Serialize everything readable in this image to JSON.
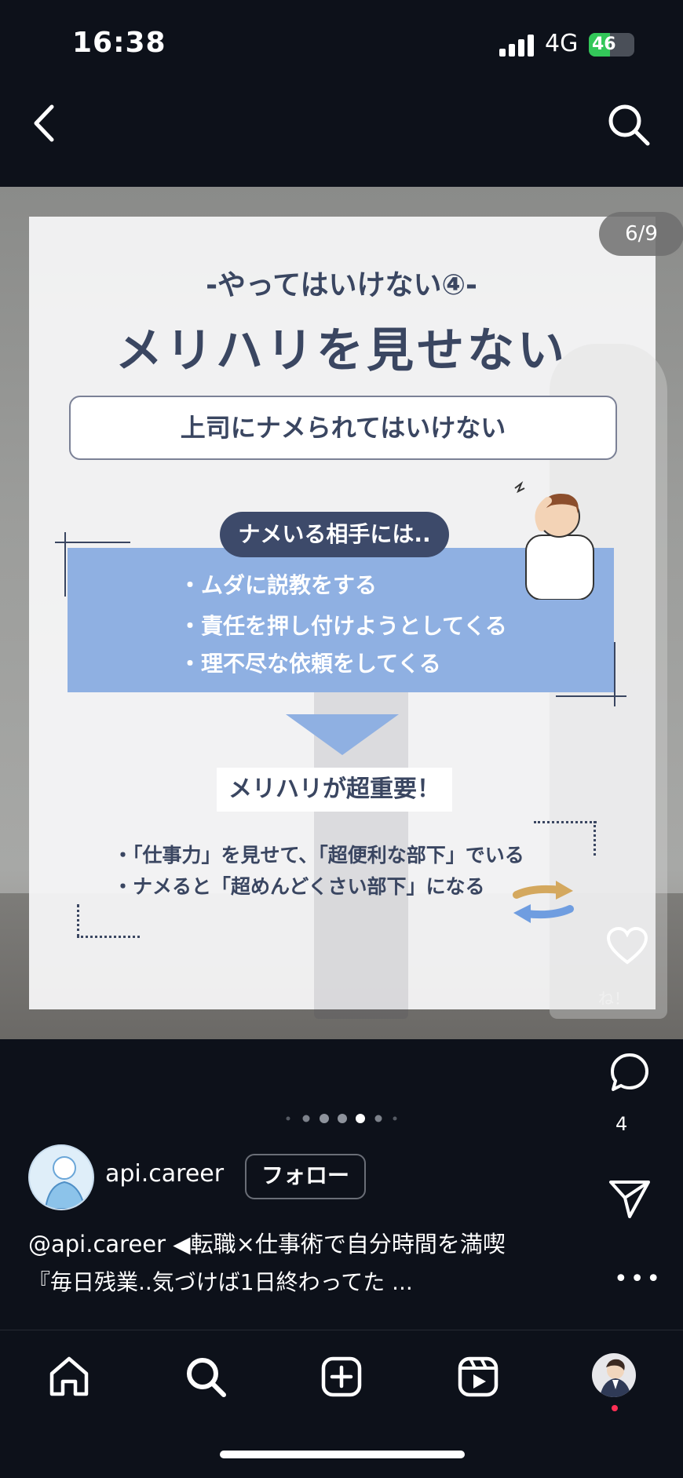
{
  "status": {
    "time": "16:38",
    "network": "4G",
    "battery": "46",
    "battery_level": 0.46
  },
  "post": {
    "counter": "6/9",
    "slide": {
      "subtitle": "-やってはいけない④-",
      "title": "メリハリを見せない",
      "subbox": "上司にナメられてはいけない",
      "pill": "ナメいる相手には..",
      "bullets": [
        "・ムダに説教をする",
        "・責任を押し付けようとしてくる",
        "・理不尽な依頼をしてくる"
      ],
      "emphasis": "メリハリが超重要！",
      "lines": [
        "・「仕事力」を見せて、「超便利な部下」でいる",
        "・ナメると「超めんどくさい部下」になる"
      ]
    },
    "like_label": "ね！",
    "comment_count": "4",
    "pagination": {
      "total": 7,
      "active": 4
    }
  },
  "profile": {
    "username": "api.career",
    "follow_label": "フォロー"
  },
  "caption": {
    "line1": "@api.career ◀転職×仕事術で自分時間を満喫",
    "line2": "『毎日残業..気づけば1日終わってた ..."
  },
  "icons": [
    "back-icon",
    "search-icon",
    "heart-icon",
    "comment-icon",
    "share-icon",
    "more-icon",
    "home-icon",
    "explore-icon",
    "create-icon",
    "reels-icon",
    "profile-icon"
  ],
  "colors": {
    "navy": "#3a4661",
    "slide_blue": "#8fb0e2",
    "battery_green": "#33c759",
    "notification": "#ff2f55"
  }
}
